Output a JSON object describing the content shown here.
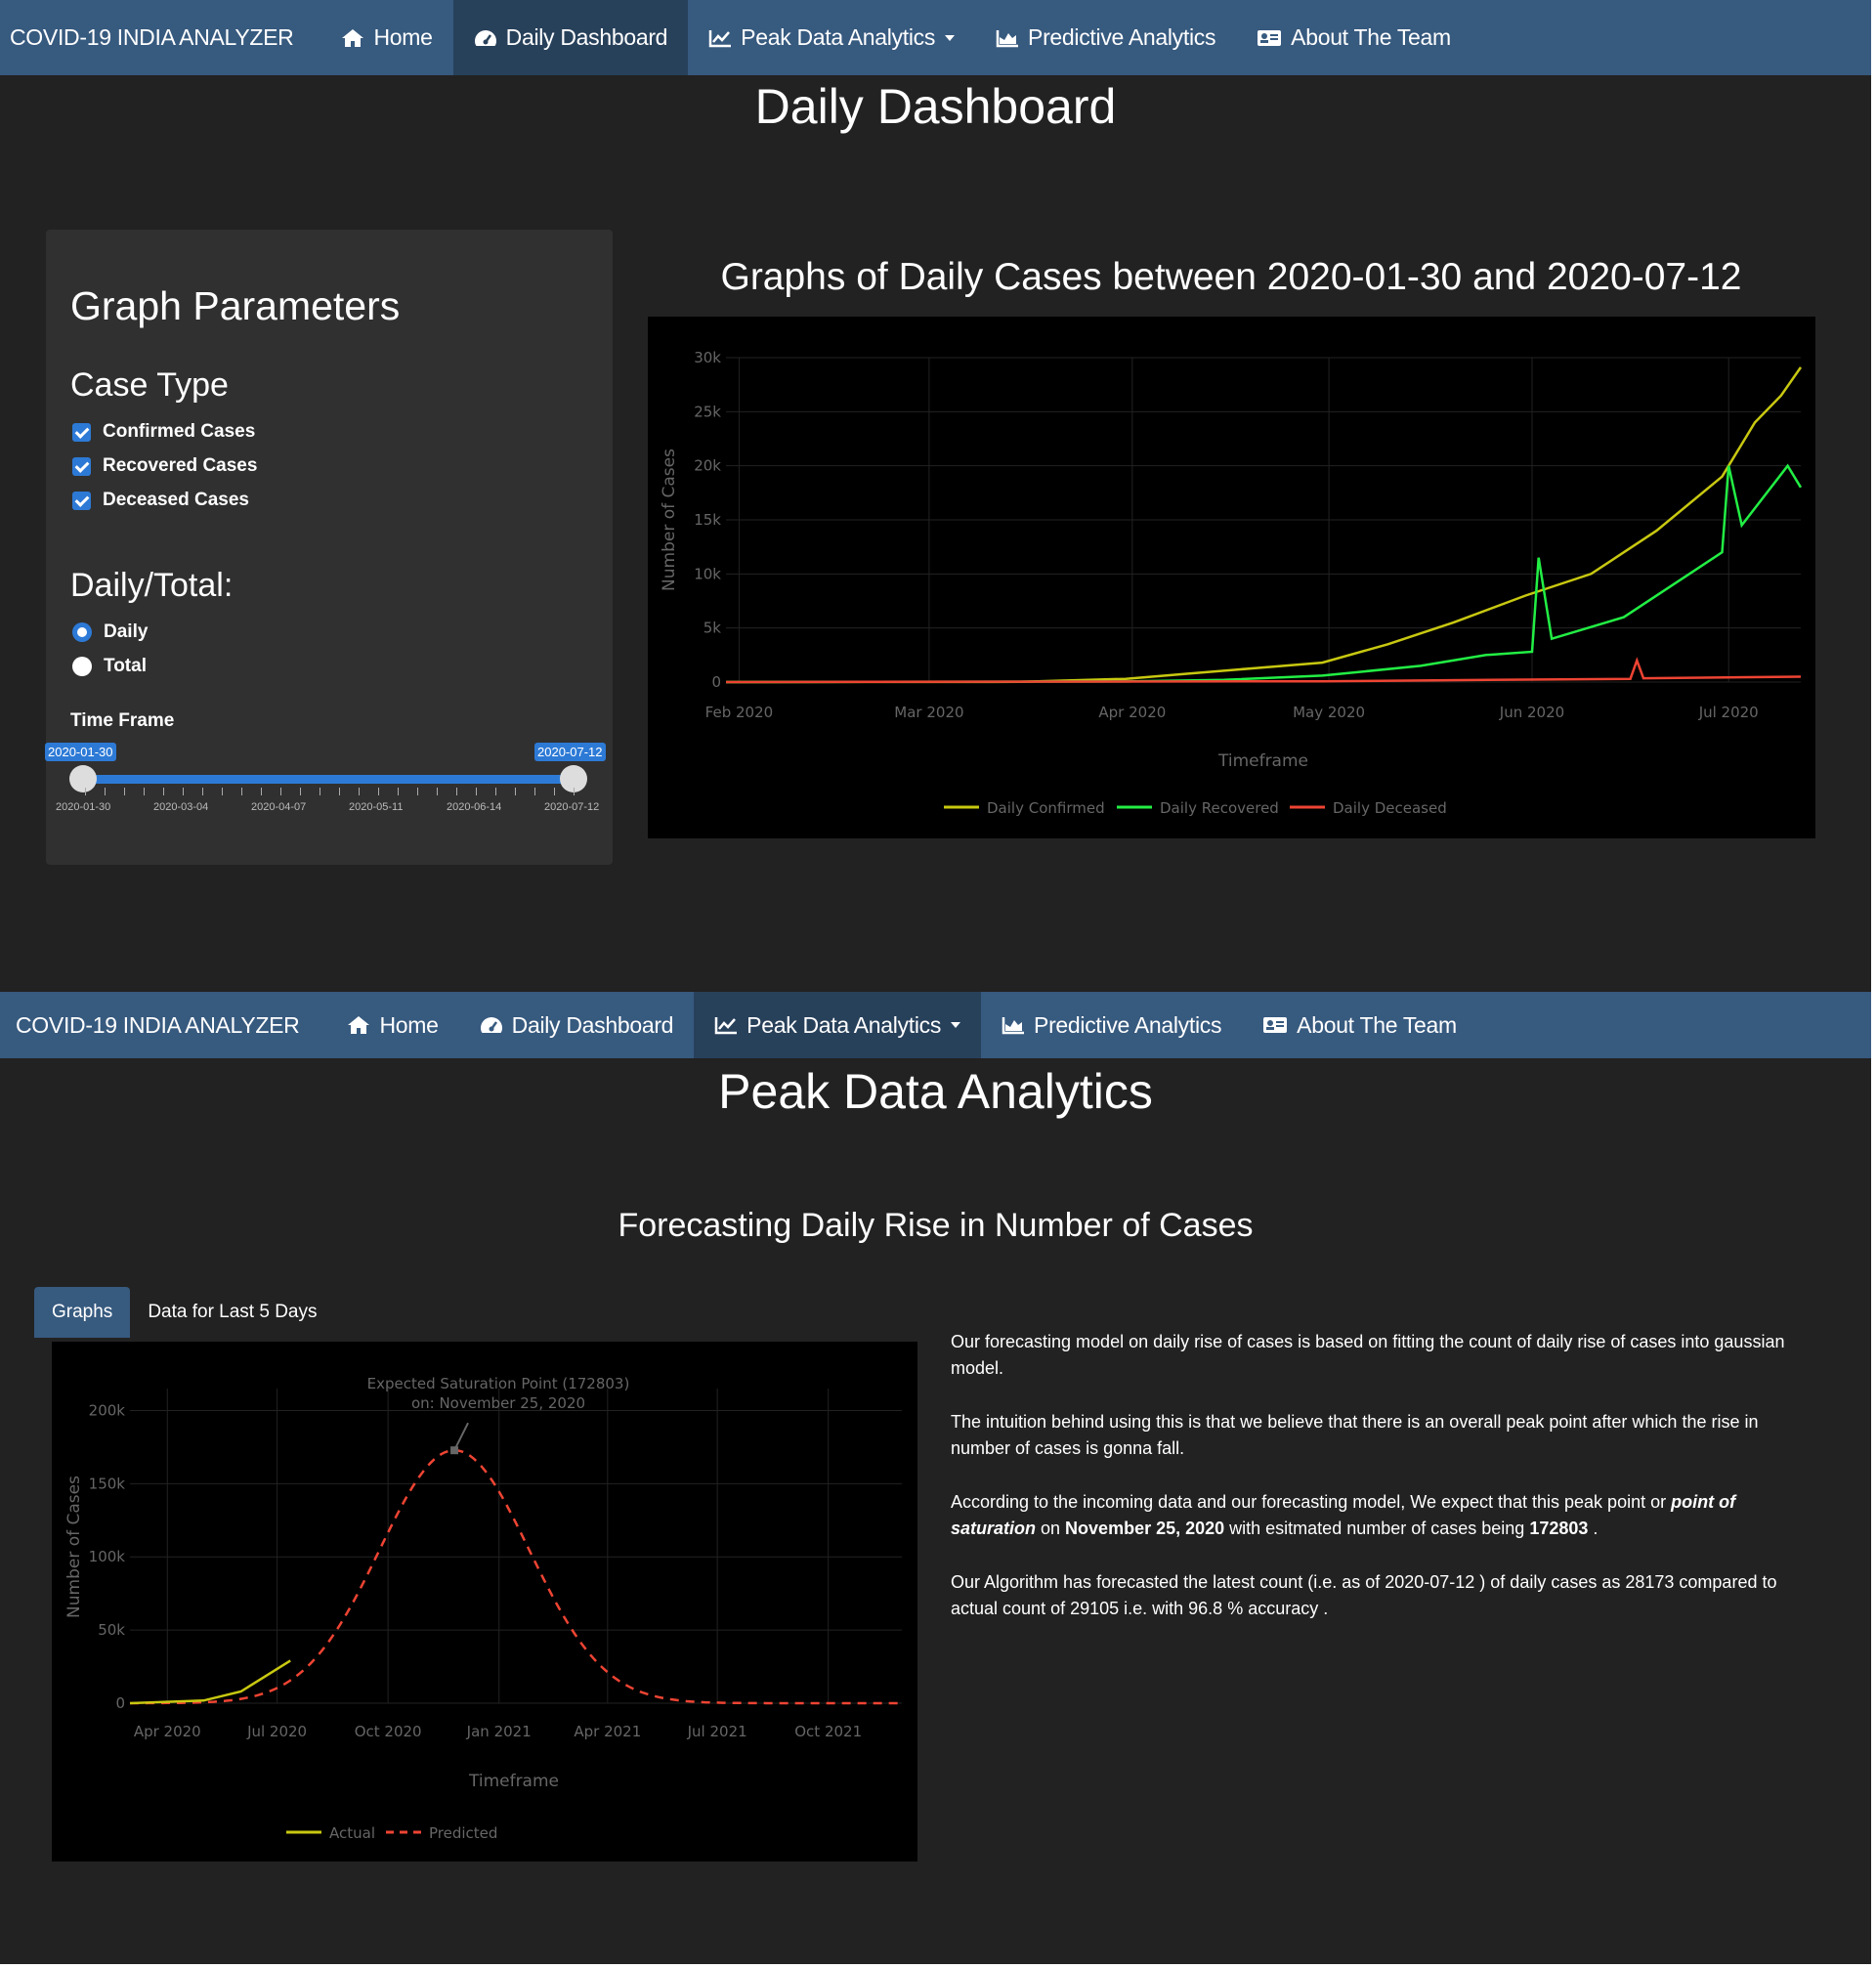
{
  "nav": {
    "brand": "COVID-19 INDIA ANALYZER",
    "items": [
      {
        "label": "Home",
        "icon": "home-icon"
      },
      {
        "label": "Daily Dashboard",
        "icon": "dashboard-icon"
      },
      {
        "label": "Peak Data Analytics",
        "icon": "line-chart-icon"
      },
      {
        "label": "Predictive Analytics",
        "icon": "area-chart-icon"
      },
      {
        "label": "About The Team",
        "icon": "id-card-icon"
      }
    ]
  },
  "dashboard": {
    "title": "Daily Dashboard",
    "params_title": "Graph Parameters",
    "case_type_label": "Case Type",
    "case_types": [
      {
        "label": "Confirmed Cases",
        "checked": true
      },
      {
        "label": "Recovered Cases",
        "checked": true
      },
      {
        "label": "Deceased Cases",
        "checked": true
      }
    ],
    "daily_total_label": "Daily/Total:",
    "radio_options": [
      {
        "label": "Daily",
        "selected": true
      },
      {
        "label": "Total",
        "selected": false
      }
    ],
    "time_frame_label": "Time Frame",
    "slider": {
      "from": "2020-01-30",
      "to": "2020-07-12",
      "tick_labels": [
        "2020-01-30",
        "2020-03-04",
        "2020-04-07",
        "2020-05-11",
        "2020-06-14",
        "2020-07-12"
      ]
    },
    "chart_title": "Graphs of Daily Cases between 2020-01-30 and 2020-07-12"
  },
  "peak": {
    "title": "Peak Data Analytics",
    "subtitle": "Forecasting Daily Rise in Number of Cases",
    "tabs": [
      "Graphs",
      "Data for Last 5 Days"
    ],
    "annotation_line1": "Expected Saturation Point (172803)",
    "annotation_line2": "on: November 25, 2020",
    "p1": "Our forecasting model on daily rise of cases is based on fitting the count of daily rise of cases into gaussian model.",
    "p2": "The intuition behind using this is that we believe that there is an overall peak point after which the rise in number of cases is gonna fall.",
    "p3_a": "According to the incoming data and our forecasting model, We expect that this peak point or ",
    "p3_em": "point of saturation",
    "p3_b": " on ",
    "p3_date": "November 25, 2020",
    "p3_c": " with esitmated number of cases being ",
    "p3_num": "172803",
    "p3_d": " .",
    "p4": "Our Algorithm has forecasted the latest count (i.e. as of 2020-07-12 ) of daily cases as 28173 compared to actual count of 29105 i.e. with 96.8 % accuracy ."
  },
  "colors": {
    "navbar": "#375a7f",
    "nav_active": "#28415b",
    "accent": "#2d7ad6",
    "confirmed": "#c8c811",
    "recovered": "#22ee44",
    "deceased": "#ee4433",
    "predicted": "#ee4433"
  },
  "chart_data": [
    {
      "type": "line",
      "xlabel": "Timeframe",
      "ylabel": "Number of Cases",
      "x_tick_labels": [
        "Feb 2020",
        "Mar 2020",
        "Apr 2020",
        "May 2020",
        "Jun 2020",
        "Jul 2020"
      ],
      "y_tick_labels": [
        "0",
        "5k",
        "10k",
        "15k",
        "20k",
        "25k",
        "30k"
      ],
      "ylim": [
        0,
        30000
      ],
      "xlim": [
        "2020-01-30",
        "2020-07-12"
      ],
      "legend": "bottom",
      "series": [
        {
          "name": "Daily Confirmed",
          "points": [
            [
              "2020-01-30",
              0
            ],
            [
              "2020-03-15",
              20
            ],
            [
              "2020-03-31",
              300
            ],
            [
              "2020-04-10",
              800
            ],
            [
              "2020-04-20",
              1300
            ],
            [
              "2020-04-30",
              1800
            ],
            [
              "2020-05-10",
              3500
            ],
            [
              "2020-05-20",
              5500
            ],
            [
              "2020-05-31",
              8000
            ],
            [
              "2020-06-10",
              10000
            ],
            [
              "2020-06-20",
              14000
            ],
            [
              "2020-06-30",
              19000
            ],
            [
              "2020-07-05",
              24000
            ],
            [
              "2020-07-09",
              26500
            ],
            [
              "2020-07-12",
              29105
            ]
          ]
        },
        {
          "name": "Daily Recovered",
          "points": [
            [
              "2020-01-30",
              0
            ],
            [
              "2020-03-31",
              50
            ],
            [
              "2020-04-15",
              200
            ],
            [
              "2020-04-30",
              600
            ],
            [
              "2020-05-15",
              1500
            ],
            [
              "2020-05-25",
              2500
            ],
            [
              "2020-06-01",
              2800
            ],
            [
              "2020-06-02",
              11500
            ],
            [
              "2020-06-04",
              4000
            ],
            [
              "2020-06-15",
              6000
            ],
            [
              "2020-06-25",
              10000
            ],
            [
              "2020-06-30",
              12000
            ],
            [
              "2020-07-01",
              20000
            ],
            [
              "2020-07-03",
              14500
            ],
            [
              "2020-07-10",
              20000
            ],
            [
              "2020-07-12",
              18000
            ]
          ]
        },
        {
          "name": "Daily Deceased",
          "points": [
            [
              "2020-01-30",
              0
            ],
            [
              "2020-04-30",
              70
            ],
            [
              "2020-05-31",
              230
            ],
            [
              "2020-06-16",
              300
            ],
            [
              "2020-06-17",
              2000
            ],
            [
              "2020-06-18",
              350
            ],
            [
              "2020-07-12",
              500
            ]
          ]
        }
      ]
    },
    {
      "type": "line",
      "xlabel": "Timeframe",
      "ylabel": "Number of Cases",
      "x_tick_labels": [
        "Apr 2020",
        "Jul 2020",
        "Oct 2020",
        "Jan 2021",
        "Apr 2021",
        "Jul 2021",
        "Oct 2021"
      ],
      "y_tick_labels": [
        "0",
        "50k",
        "100k",
        "150k",
        "200k"
      ],
      "ylim": [
        0,
        215000
      ],
      "legend": "bottom",
      "series": [
        {
          "name": "Actual",
          "points": [
            [
              "2020-03-01",
              0
            ],
            [
              "2020-05-01",
              1800
            ],
            [
              "2020-06-01",
              8000
            ],
            [
              "2020-07-12",
              29105
            ]
          ]
        },
        {
          "name": "Predicted",
          "peak": 172803,
          "peak_date": "2020-11-25",
          "end": "2021-12-01"
        }
      ]
    }
  ]
}
